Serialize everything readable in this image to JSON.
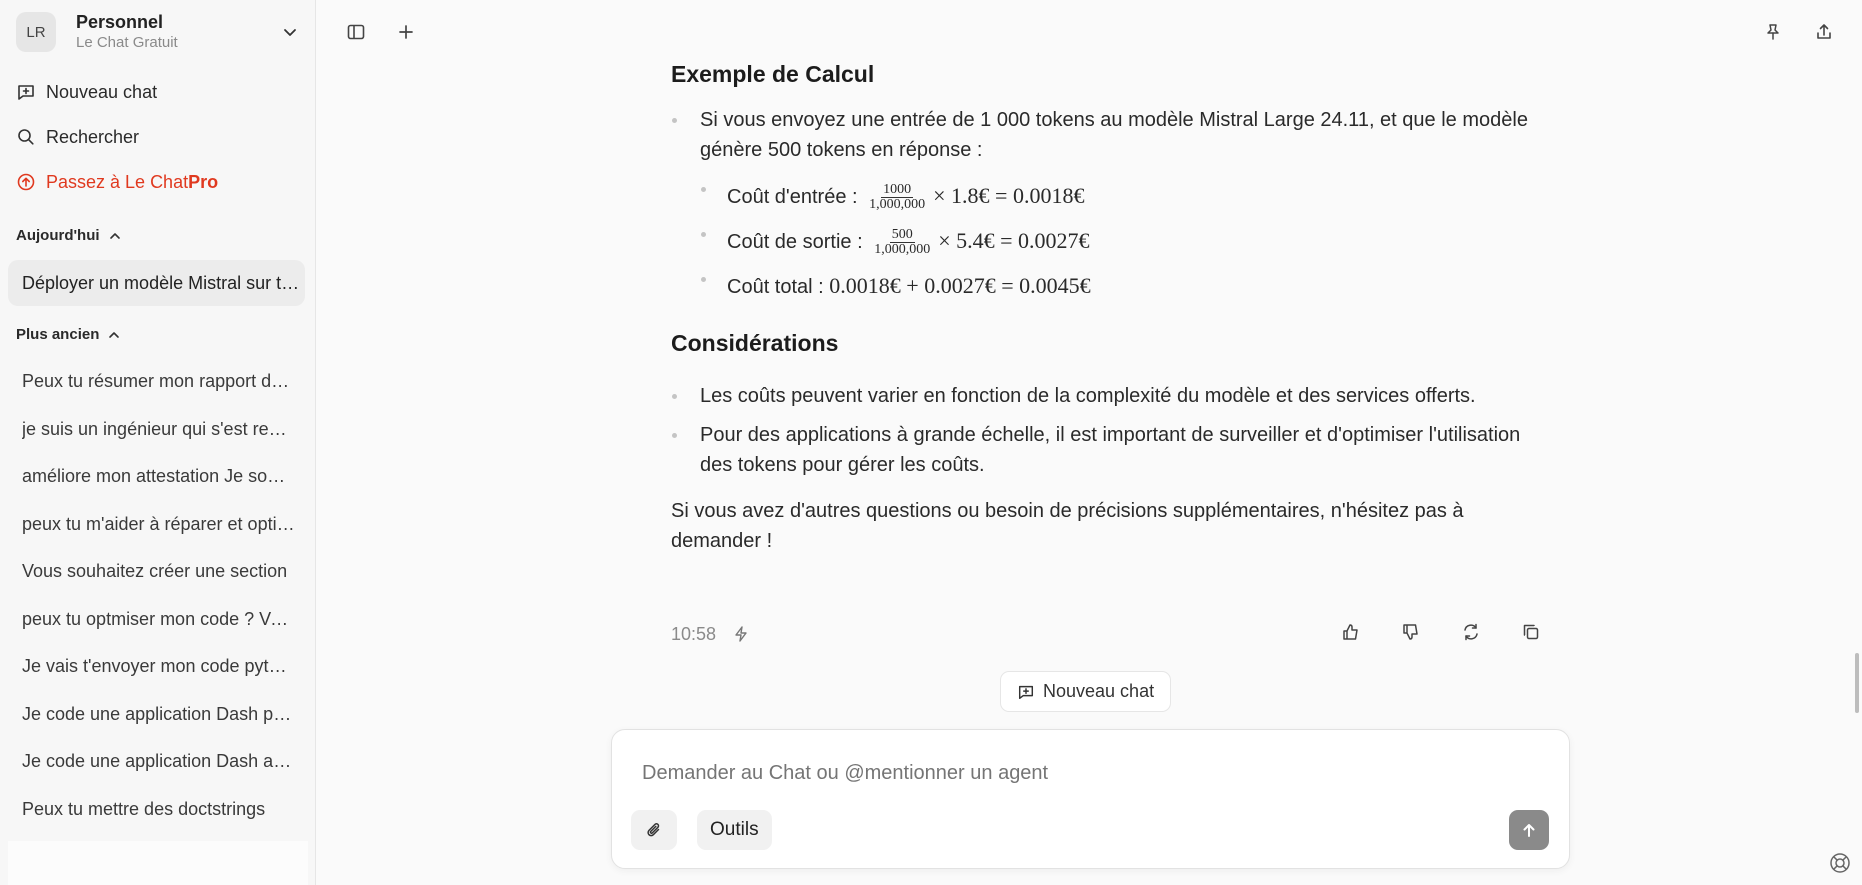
{
  "sidebar": {
    "account": {
      "initials": "LR",
      "name": "Personnel",
      "plan": "Le Chat Gratuit"
    },
    "nav": {
      "new_chat": "Nouveau chat",
      "search": "Rechercher",
      "upgrade_prefix": "Passez à Le Chat ",
      "upgrade_suffix": "Pro"
    },
    "today_label": "Aujourd'hui",
    "today_items": [
      "Déployer un modèle Mistral sur ton serveur"
    ],
    "older_label": "Plus ancien",
    "older_items": [
      "Peux tu résumer mon rapport de stage",
      "je suis un ingénieur qui s'est reconverti",
      "améliore mon attestation Je soussigné",
      "peux tu m'aider à réparer et optimiser",
      "Vous souhaitez créer une section",
      "peux tu optmiser mon code ? Voici",
      "Je vais t'envoyer mon code python",
      "Je code une application Dash pour",
      "Je code une application Dash avec",
      "Peux tu mettre des doctstrings"
    ]
  },
  "message": {
    "heading_example": "Exemple de Calcul",
    "example_bullet": "Si vous envoyez une entrée de 1 000 tokens au modèle Mistral Large 24.11, et que le modèle génère 500 tokens en réponse :",
    "cost_input_label": "Coût d'entrée : ",
    "cost_input_num": "1000",
    "cost_input_den": "1,000,000",
    "cost_input_rest": "× 1.8€ = 0.0018€",
    "cost_output_label": "Coût de sortie : ",
    "cost_output_num": "500",
    "cost_output_den": "1,000,000",
    "cost_output_rest": "× 5.4€ = 0.0027€",
    "cost_total_label": "Coût total : ",
    "cost_total_rest": "0.0018€ + 0.0027€ = 0.0045€",
    "heading_considerations": "Considérations",
    "consideration_1": "Les coûts peuvent varier en fonction de la complexité du modèle et des services offerts.",
    "consideration_2": "Pour des applications à grande échelle, il est important de surveiller et d'optimiser l'utilisation des tokens pour gérer les coûts.",
    "closing": "Si vous avez d'autres questions ou besoin de précisions supplémentaires, n'hésitez pas à demander !",
    "time": "10:58"
  },
  "new_chat_pill": "Nouveau chat",
  "composer": {
    "placeholder": "Demander au Chat ou @mentionner un agent",
    "tools_label": "Outils"
  },
  "colors": {
    "accent_red": "#e0391f",
    "send_button": "#8a8a8a"
  }
}
